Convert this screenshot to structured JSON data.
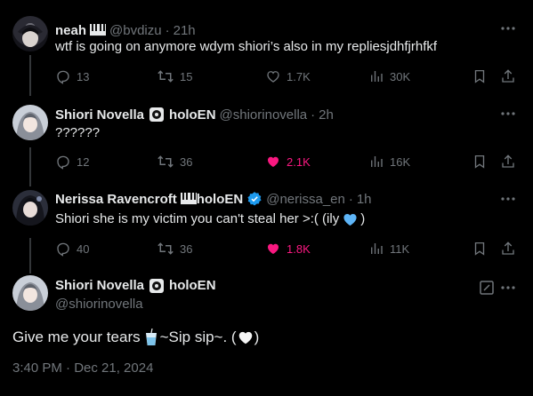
{
  "tweets": [
    {
      "name": "neah",
      "handle": "@bvdizu",
      "time": "21h",
      "text": "wtf is going on anymore wdym shiori’s also in my repliesjdhfjrhfkf",
      "replies": "13",
      "reposts": "15",
      "likes": "1.7K",
      "views": "30K",
      "liked": false
    },
    {
      "name": "Shiori Novella",
      "org": "holoEN",
      "handle": "@shiorinovella",
      "time": "2h",
      "text": "??????",
      "replies": "12",
      "reposts": "36",
      "likes": "2.1K",
      "views": "16K",
      "liked": true
    },
    {
      "name": "Nerissa Ravencroft",
      "org": "holoEN",
      "handle": "@nerissa_en",
      "time": "1h",
      "text": "Shiori she is my victim you can't steal her >:( (ily",
      "text_end": ")",
      "replies": "40",
      "reposts": "36",
      "likes": "1.8K",
      "views": "11K",
      "liked": true
    }
  ],
  "main": {
    "name": "Shiori Novella",
    "org": "holoEN",
    "handle": "@shiorinovella",
    "text_start": "Give me your tears",
    "text_mid": "~Sip sip~. (",
    "text_end": ")",
    "timestamp": "3:40 PM · Dec 21, 2024"
  },
  "separator": "·",
  "icons": {
    "more": "more-horizontal-icon",
    "reply": "reply-icon",
    "repost": "repost-icon",
    "like": "heart-icon",
    "views": "views-icon",
    "bookmark": "bookmark-icon",
    "share": "share-icon",
    "edit": "edit-icon"
  },
  "colors": {
    "background": "#000000",
    "text": "#e7e9ea",
    "muted": "#71767b",
    "like": "#f91880",
    "verified": "#1d9bf0",
    "heart_blue": "#5eb5f7"
  }
}
